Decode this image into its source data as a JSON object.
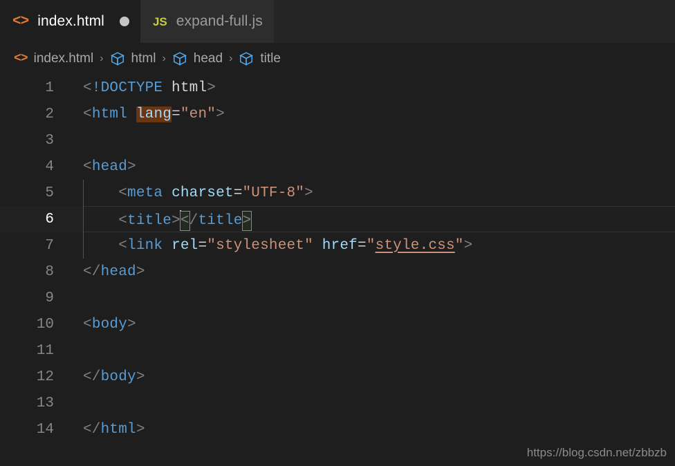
{
  "tabs": [
    {
      "label": "index.html",
      "icon": "html-file-icon",
      "icon_glyph": "<>",
      "active": true,
      "dirty": true
    },
    {
      "label": "expand-full.js",
      "icon": "js-file-icon",
      "icon_glyph": "JS",
      "active": false,
      "dirty": false
    }
  ],
  "breadcrumb": {
    "items": [
      {
        "label": "index.html",
        "icon": "html-file-icon",
        "glyph": "<>"
      },
      {
        "label": "html",
        "icon": "symbol-cube-icon",
        "glyph": "cube"
      },
      {
        "label": "head",
        "icon": "symbol-cube-icon",
        "glyph": "cube"
      },
      {
        "label": "title",
        "icon": "symbol-cube-icon",
        "glyph": "cube"
      }
    ],
    "separator": "›"
  },
  "editor": {
    "language": "html",
    "active_line": 6,
    "cursor_line": 6,
    "cursor_column": 12,
    "line_numbers": [
      "1",
      "2",
      "3",
      "4",
      "5",
      "6",
      "7",
      "8",
      "9",
      "10",
      "11",
      "12",
      "13",
      "14"
    ],
    "lines": [
      {
        "n": "1",
        "text": "<!DOCTYPE html>"
      },
      {
        "n": "2",
        "text": "<html lang=\"en\">"
      },
      {
        "n": "3",
        "text": ""
      },
      {
        "n": "4",
        "text": "<head>"
      },
      {
        "n": "5",
        "text": "    <meta charset=\"UTF-8\">"
      },
      {
        "n": "6",
        "text": "    <title></title>"
      },
      {
        "n": "7",
        "text": "    <link rel=\"stylesheet\" href=\"style.css\">"
      },
      {
        "n": "8",
        "text": "</head>"
      },
      {
        "n": "9",
        "text": ""
      },
      {
        "n": "10",
        "text": "<body>"
      },
      {
        "n": "11",
        "text": ""
      },
      {
        "n": "12",
        "text": "</body>"
      },
      {
        "n": "13",
        "text": ""
      },
      {
        "n": "14",
        "text": "</html>"
      }
    ],
    "highlighted_word": "lang",
    "link_text": "style.css"
  },
  "watermark": "https://blog.csdn.net/zbbzb",
  "colors": {
    "editor_background": "#1e1e1e",
    "tab_active_background": "#1e1e1e",
    "tab_inactive_background": "#2d2d2d",
    "tag": "#569cd6",
    "attribute": "#9cdcfe",
    "string": "#ce9178",
    "punctuation": "#808080",
    "html_icon": "#e37933",
    "js_icon": "#cbcb41",
    "symbol_icon": "#4fa8e8",
    "word_highlight": "#6a3512"
  }
}
